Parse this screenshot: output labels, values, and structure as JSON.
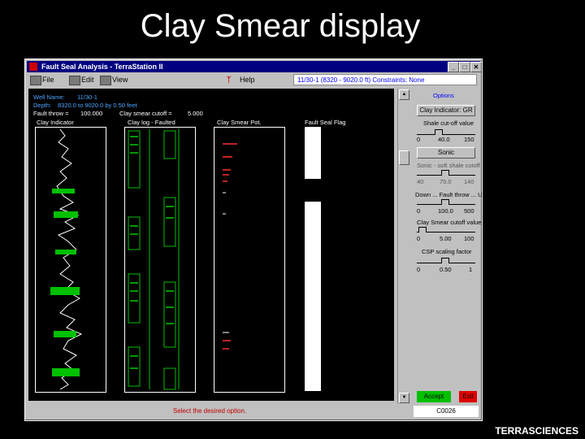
{
  "slide": {
    "title": "Clay Smear display",
    "footer": "TERRASCIENCES"
  },
  "window": {
    "title": "Fault Seal Analysis - TerraStation II",
    "menu": {
      "file": "File",
      "edit": "Edit",
      "view": "View",
      "help": "Help"
    },
    "constraints": "11/30-1 (8320 - 9020.0 ft) Constraints: None",
    "status": "Select the desired option.",
    "coords": "C0026"
  },
  "plot": {
    "well_name_label": "Well Name:",
    "well_name_value": "11/30-1",
    "depth_label": "Depth:",
    "depth_value": "8320.0 to 9020.0 by 0.50 feet",
    "fault_throw_label": "Fault throw =",
    "fault_throw_value": "100.000",
    "clay_smear_cutoff_label": "Clay smear cutoff =",
    "clay_smear_cutoff_value": "5.000",
    "track_headers": [
      "Clay Indicator",
      "Clay log - Faulted",
      "Clay Smear Pot.",
      "Fault Seal Flag"
    ]
  },
  "panel": {
    "options_label": "Options",
    "clay_indicator_button": "Clay Indicator: GR",
    "shale_cutoff_label": "Shale cut-off value",
    "shale_scale": [
      "0",
      "40.0",
      "150"
    ],
    "sonic_button": "Sonic",
    "sonic_shale_label": "Sonic - soft shale cutoff",
    "sonic_scale": [
      "40",
      "75.0",
      "140"
    ],
    "fault_throw_label": "Down ... Fault throw ... Up",
    "fault_throw_scale": [
      "0",
      "100.0",
      "500"
    ],
    "clay_smear_label": "Clay Smear cutoff value",
    "clay_smear_scale": [
      "0",
      "5.00",
      "100"
    ],
    "csp_label": "CSP scaling factor",
    "csp_scale": [
      "0",
      "0.50",
      "1"
    ],
    "accept": "Accept",
    "exit": "Exit"
  },
  "colors": {
    "accent_blue": "#4da6ff",
    "clay_green": "#00c000",
    "smear_red": "#ff3030",
    "titlebar": "#000080"
  }
}
